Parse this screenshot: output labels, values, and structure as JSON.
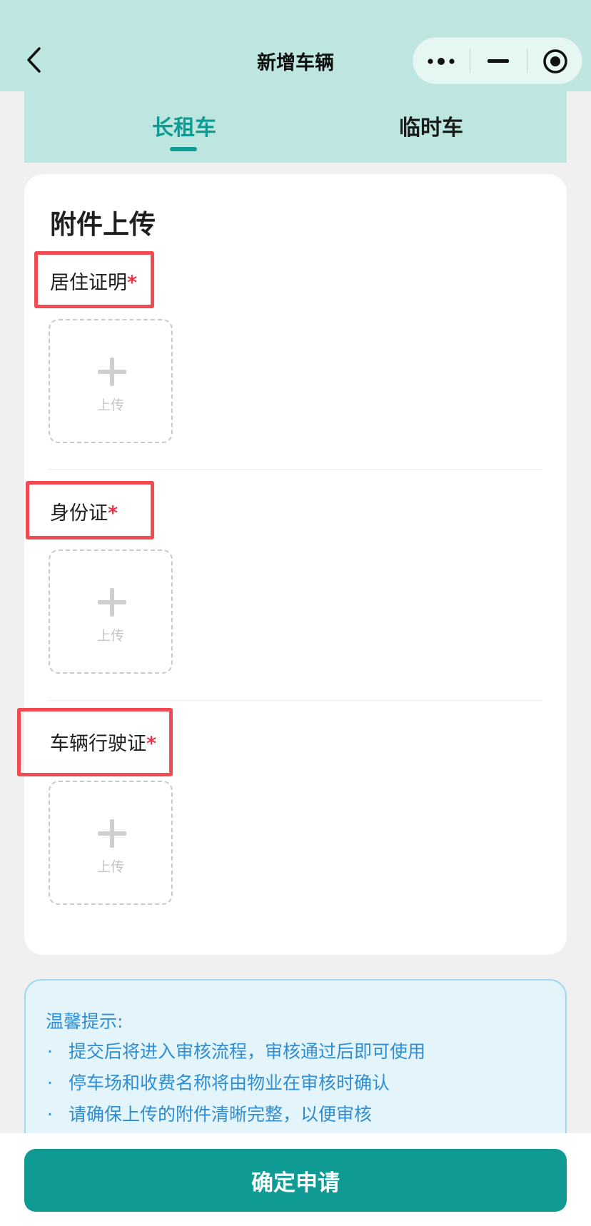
{
  "navbar": {
    "title": "新增车辆"
  },
  "tabs": [
    {
      "label": "长租车",
      "active": true
    },
    {
      "label": "临时车",
      "active": false
    }
  ],
  "card": {
    "title": "附件上传",
    "sections": [
      {
        "label": "居住证明",
        "required_mark": "*",
        "upload_label": "上传"
      },
      {
        "label": "身份证",
        "required_mark": "*",
        "upload_label": "上传"
      },
      {
        "label": "车辆行驶证",
        "required_mark": "*",
        "upload_label": "上传"
      }
    ]
  },
  "tips": {
    "title": "温馨提示:",
    "items": [
      "提交后将进入审核流程，审核通过后即可使用",
      "停车场和收费名称将由物业在审核时确认",
      "请确保上传的附件清晰完整，以便审核"
    ],
    "bullet": "·"
  },
  "submit": {
    "label": "确定申请"
  },
  "colors": {
    "accent": "#0f9a94",
    "header_bg": "#bce6df",
    "required": "#e8334b",
    "tip_text": "#2f8ed2",
    "highlight": "#ef4b51"
  }
}
